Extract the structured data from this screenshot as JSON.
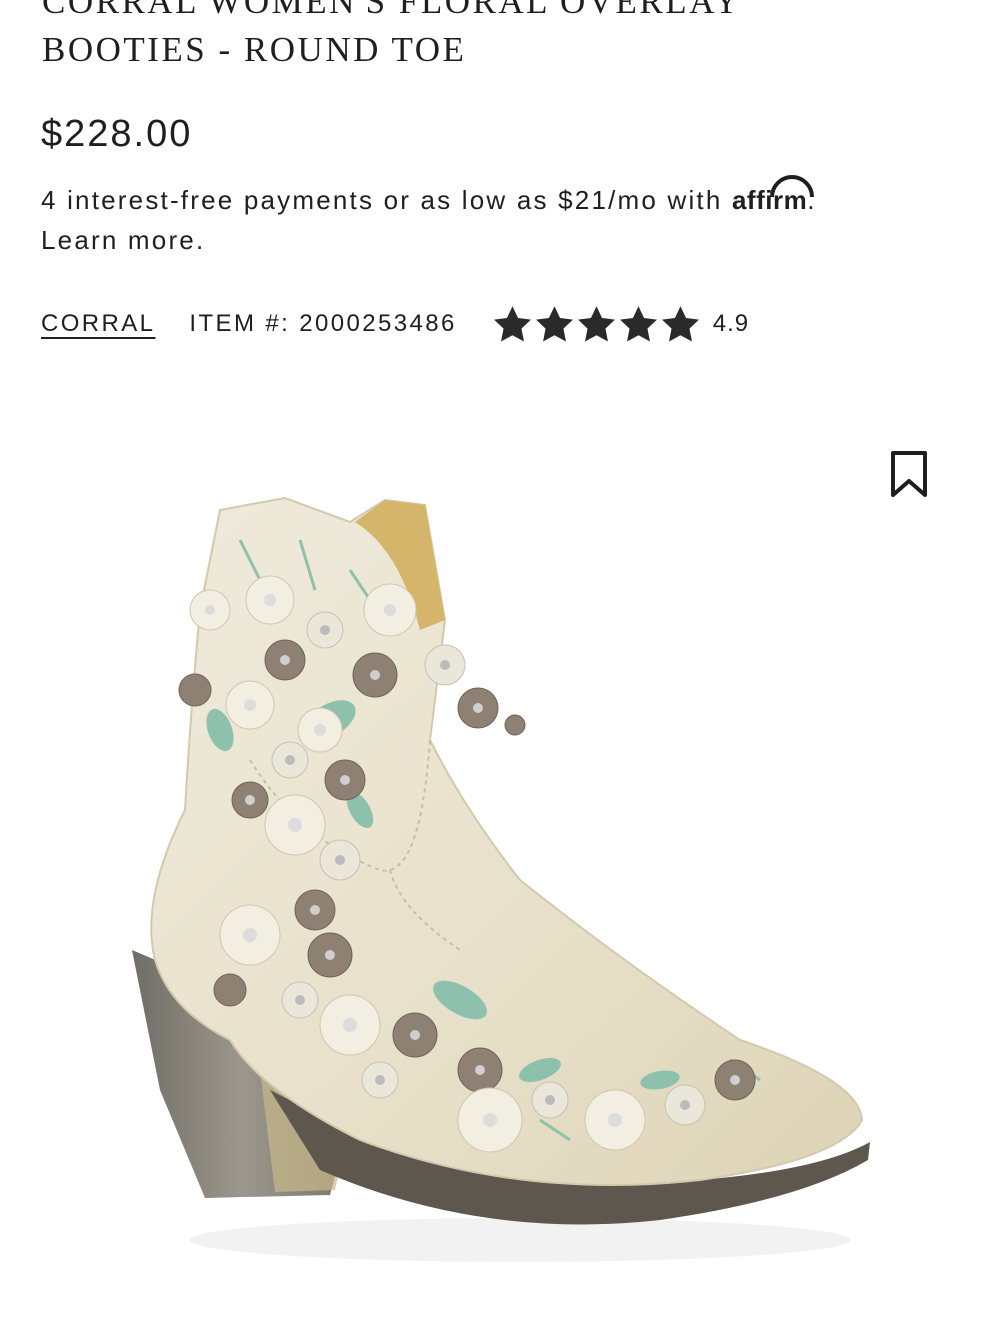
{
  "product": {
    "title_line1": "CORRAL WOMEN'S FLORAL OVERLAY",
    "title_line2": "BOOTIES - ROUND TOE",
    "price": "$228.00"
  },
  "financing": {
    "text": "4 interest-free payments or as low as $21/mo with",
    "provider_logo": "affirm",
    "period": ".",
    "learn_more": "Learn more."
  },
  "meta": {
    "brand": "CORRAL",
    "item_number": "ITEM #: 2000253486",
    "rating": "4.9",
    "star_count": 5
  },
  "icons": {
    "star": "star-icon",
    "bookmark": "bookmark-icon"
  },
  "colors": {
    "text": "#1f1f1f",
    "star": "#2a2a2a"
  }
}
